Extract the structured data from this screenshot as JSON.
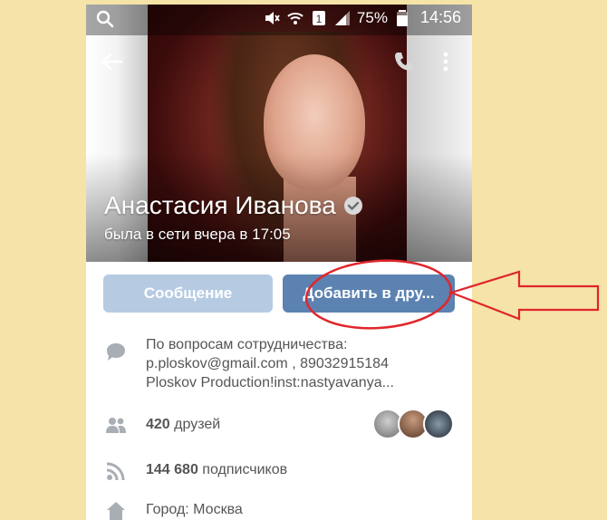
{
  "status_bar": {
    "battery_percent": "75%",
    "time": "14:56",
    "sim_label": "1"
  },
  "profile": {
    "name": "Анастасия Иванова",
    "online_status": "была в сети вчера в 17:05"
  },
  "actions": {
    "message_label": "Сообщение",
    "add_friend_label": "Добавить в дру..."
  },
  "info": {
    "about_line1": "По вопросам сотрудничества:",
    "about_line2": "p.ploskov@gmail.com , 89032915184",
    "about_line3": "Ploskov Production!inst:nastyavanya...",
    "friends_count": "420",
    "friends_label": "друзей",
    "followers_count": "144 680",
    "followers_label": "подписчиков",
    "city": "Город: Москва"
  },
  "colors": {
    "page_background": "#f5e3a8",
    "message_button": "#b6cbe2",
    "add_friend_button": "#5b82b1",
    "annotation": "#e0262b"
  }
}
